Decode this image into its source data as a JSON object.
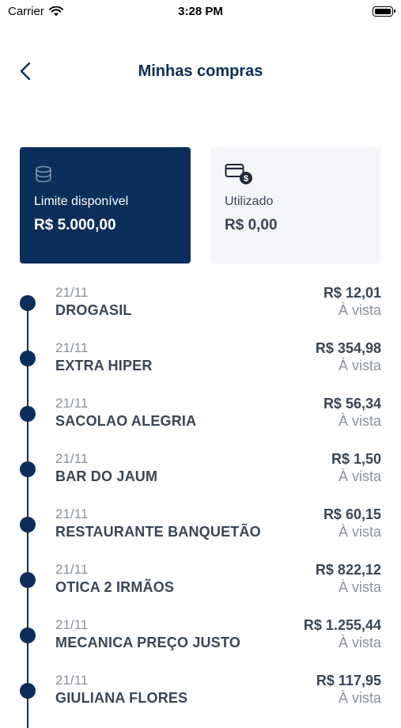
{
  "status_bar": {
    "carrier": "Carrier",
    "time": "3:28 PM"
  },
  "header": {
    "title": "Minhas compras"
  },
  "cards": {
    "available": {
      "label": "Limite disponível",
      "value": "R$ 5.000,00"
    },
    "used": {
      "label": "Utilizado",
      "value": "R$ 0,00"
    }
  },
  "purchases": [
    {
      "date": "21/11",
      "merchant": "DROGASIL",
      "amount": "R$ 12,01",
      "method": "À vista"
    },
    {
      "date": "21/11",
      "merchant": "EXTRA HIPER",
      "amount": "R$ 354,98",
      "method": "À vista"
    },
    {
      "date": "21/11",
      "merchant": "SACOLAO ALEGRIA",
      "amount": "R$ 56,34",
      "method": "À vista"
    },
    {
      "date": "21/11",
      "merchant": "BAR DO JAUM",
      "amount": "R$ 1,50",
      "method": "À vista"
    },
    {
      "date": "21/11",
      "merchant": "RESTAURANTE BANQUETÃO",
      "amount": "R$ 60,15",
      "method": "À vista"
    },
    {
      "date": "21/11",
      "merchant": "OTICA 2 IRMÃOS",
      "amount": "R$ 822,12",
      "method": "À vista"
    },
    {
      "date": "21/11",
      "merchant": "MECANICA PREÇO JUSTO",
      "amount": "R$ 1.255,44",
      "method": "À vista"
    },
    {
      "date": "21/11",
      "merchant": "GIULIANA FLORES",
      "amount": "R$ 117,95",
      "method": "À vista"
    }
  ]
}
